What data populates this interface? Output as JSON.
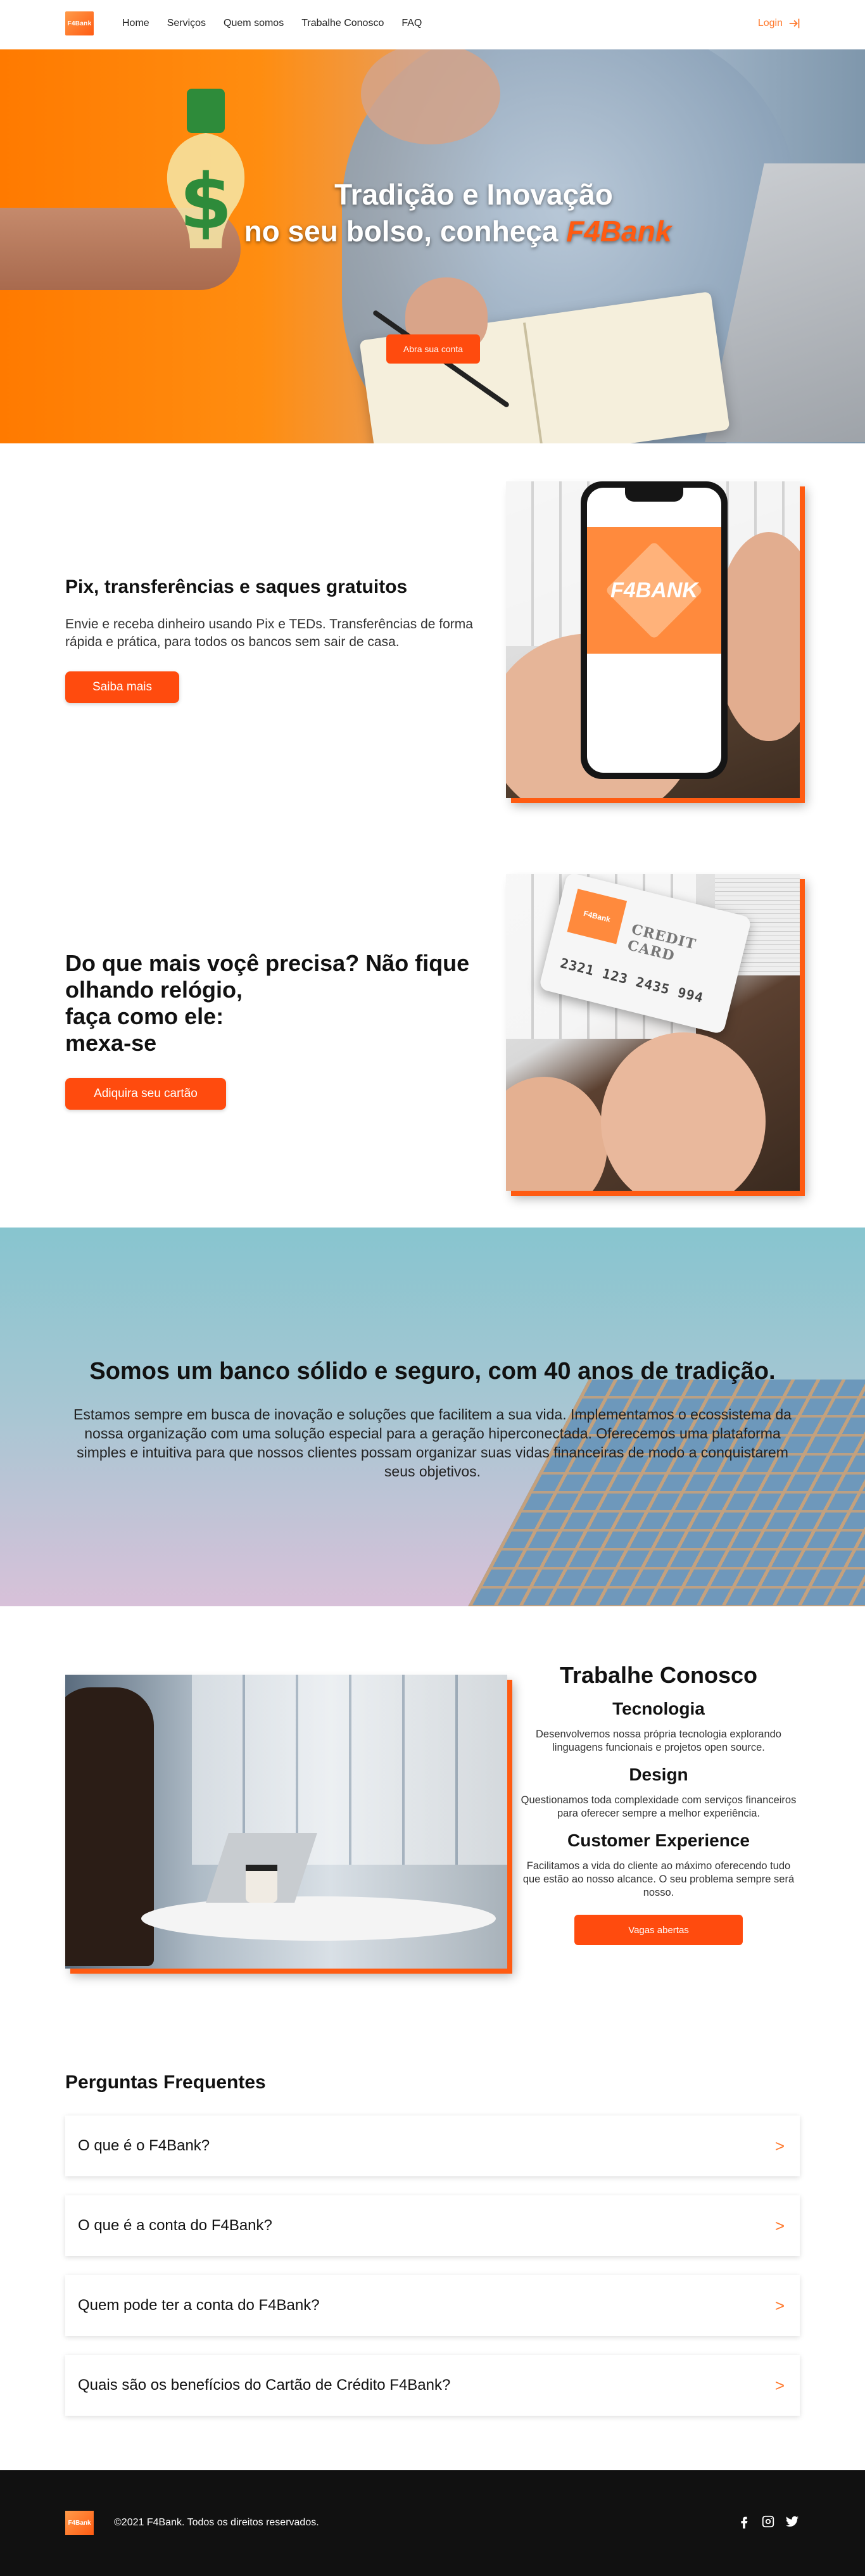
{
  "header": {
    "logo_text": "F4Bank",
    "nav": [
      "Home",
      "Serviços",
      "Quem somos",
      "Trabalhe Conosco",
      "FAQ"
    ],
    "login_label": "Login"
  },
  "hero": {
    "title_line1": "Tradição e Inovação",
    "title_line2_prefix": "no seu bolso, conheça",
    "title_brand": "F4Bank",
    "cta_label": "Abra sua conta"
  },
  "pix": {
    "title": "Pix, transferências e saques gratuitos",
    "text": "Envie e receba dinheiro usando Pix e TEDs. Transferências de forma rápida e prática, para todos os bancos sem sair de casa.",
    "button_label": "Saiba mais",
    "phone_logo": "F4BANK"
  },
  "card": {
    "title_lines": [
      "Do que mais voçê precisa? Não fique",
      "olhando relógio,",
      "faça como ele:",
      "mexa-se"
    ],
    "button_label": "Adiquira seu cartão",
    "card_logo": "F4Bank",
    "card_label": "CREDIT CARD",
    "card_number": "2321 123 2435 994"
  },
  "about": {
    "title": "Somos um banco sólido e seguro, com 40 anos de tradição.",
    "text": "Estamos sempre em busca de inovação e soluções que facilitem a sua vida. Implementamos o ecossistema da nossa organização com uma solução especial para a geração hiperconectada. Oferecemos uma plataforma simples e intuitiva para que nossos clientes possam organizar suas vidas financeiras de modo a conquistarem seus objetivos."
  },
  "work": {
    "title": "Trabalhe Conosco",
    "items": [
      {
        "heading": "Tecnologia",
        "text": "Desenvolvemos nossa própria tecnologia explorando linguagens funcionais e projetos open source."
      },
      {
        "heading": "Design",
        "text": "Questionamos toda complexidade com serviços financeiros para oferecer sempre a melhor experiência."
      },
      {
        "heading": "Customer Experience",
        "text": "Facilitamos a vida do cliente ao máximo oferecendo tudo que estão ao nosso alcance. O seu problema sempre será nosso."
      }
    ],
    "button_label": "Vagas abertas"
  },
  "faq": {
    "title": "Perguntas Frequentes",
    "items": [
      {
        "question": "O que é o F4Bank?",
        "chevron": ">"
      },
      {
        "question": "O que é a conta do F4Bank?",
        "chevron": ">"
      },
      {
        "question": "Quem pode ter a conta do F4Bank?",
        "chevron": ">"
      },
      {
        "question": "Quais são os benefícios do Cartão de Crédito F4Bank?",
        "chevron": ">"
      }
    ]
  },
  "footer": {
    "logo_text": "F4Bank",
    "copyright": "©2021 F4Bank. Todos os direitos reservados.",
    "socials": [
      "facebook-icon",
      "instagram-icon",
      "twitter-icon"
    ]
  },
  "colors": {
    "accent": "#ff4b0e",
    "accent_light": "#ff7a2e",
    "footer_bg": "#111111",
    "about_top": "#87c5cf",
    "about_bottom": "#d8c1d9"
  }
}
